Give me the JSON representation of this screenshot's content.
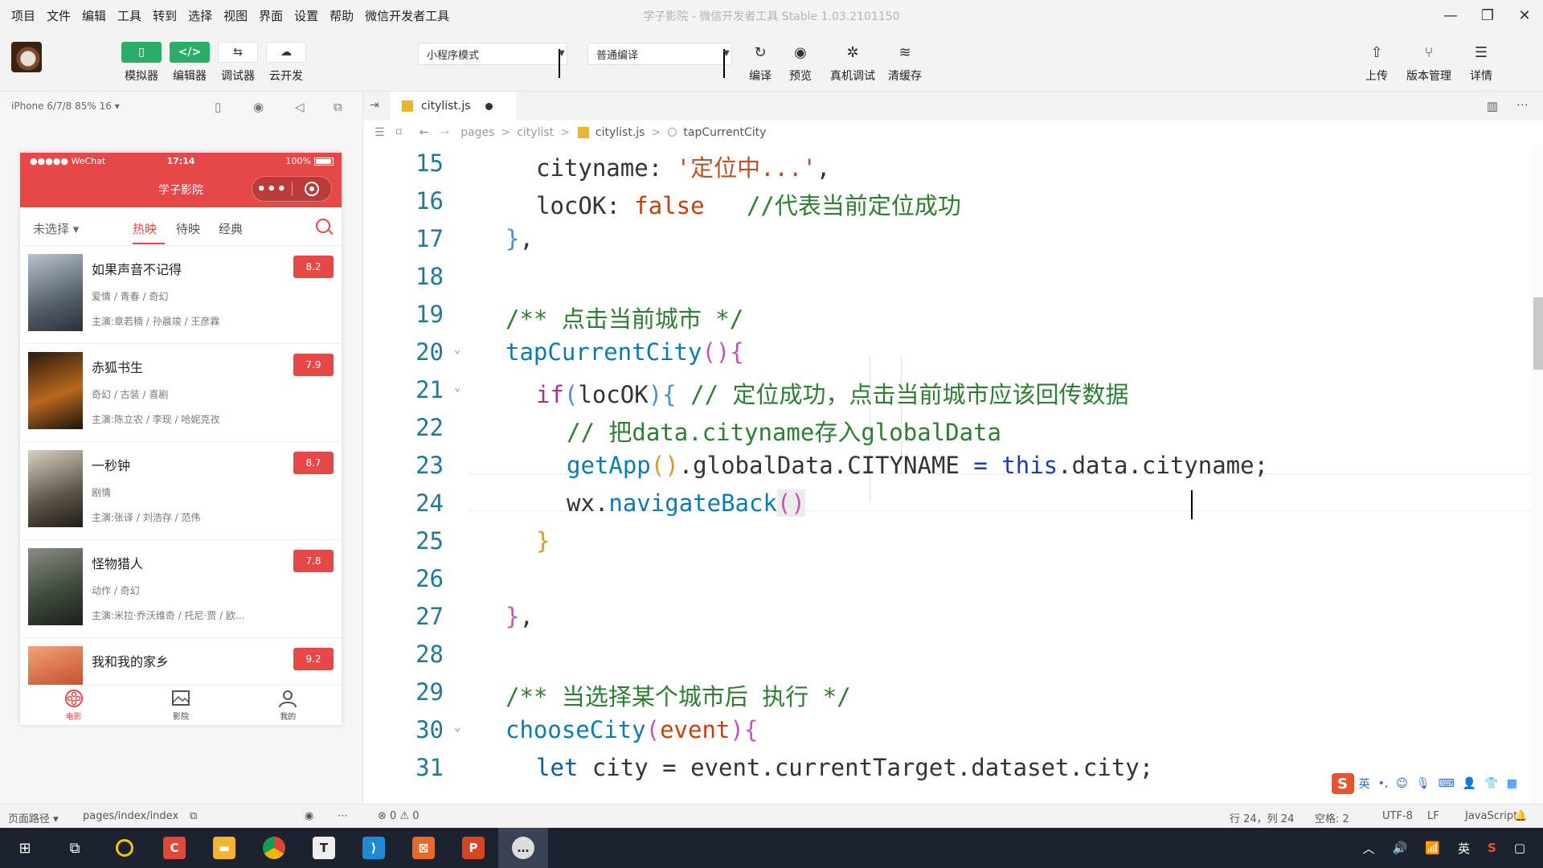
{
  "menu": [
    "项目",
    "文件",
    "编辑",
    "工具",
    "转到",
    "选择",
    "视图",
    "界面",
    "设置",
    "帮助",
    "微信开发者工具"
  ],
  "window_title": "学子影院 - 微信开发者工具 Stable 1.03.2101150",
  "toolbar": {
    "left_buttons": [
      "模拟器",
      "编辑器",
      "调试器",
      "云开发"
    ],
    "mode_select": "小程序模式",
    "compile_select": "普通编译",
    "mid_buttons": [
      "编译",
      "预览",
      "真机调试",
      "清缓存"
    ],
    "right_buttons": [
      "上传",
      "版本管理",
      "详情"
    ]
  },
  "simulator": {
    "device": "iPhone 6/7/8 85% 16 ▾",
    "status_left": "●●●●● WeChat",
    "status_time": "17:14",
    "status_battery": "100%",
    "nav_title": "学子影院",
    "capsule_dots": "•••",
    "city": "未选择 ▾",
    "tabs": [
      "热映",
      "待映",
      "经典"
    ],
    "movies": [
      {
        "name": "如果声音不记得",
        "genre": "爱情 / 青春 / 奇幻",
        "cast": "主演:章若楠 / 孙晨竣 / 王彦霖",
        "score": "8.2"
      },
      {
        "name": "赤狐书生",
        "genre": "奇幻 / 古装 / 喜剧",
        "cast": "主演:陈立农 / 李现 / 哈妮克孜",
        "score": "7.9"
      },
      {
        "name": "一秒钟",
        "genre": "剧情",
        "cast": "主演:张译 / 刘浩存 / 范伟",
        "score": "8.7"
      },
      {
        "name": "怪物猎人",
        "genre": "动作 / 奇幻",
        "cast": "主演:米拉·乔沃维奇 / 托尼·贾 / 欧...",
        "score": "7.8"
      },
      {
        "name": "我和我的家乡",
        "genre": "",
        "cast": "",
        "score": "9.2"
      }
    ],
    "tabbar": [
      "电影",
      "影院",
      "我的"
    ]
  },
  "editor": {
    "file_tab": "citylist.js",
    "breadcrumb": [
      "pages",
      "citylist",
      "citylist.js",
      "tapCurrentCity"
    ]
  },
  "code_lines": [
    {
      "n": "15"
    },
    {
      "n": "16"
    },
    {
      "n": "17"
    },
    {
      "n": "18"
    },
    {
      "n": "19"
    },
    {
      "n": "20"
    },
    {
      "n": "21"
    },
    {
      "n": "22"
    },
    {
      "n": "23"
    },
    {
      "n": "24"
    },
    {
      "n": "25"
    },
    {
      "n": "26"
    },
    {
      "n": "27"
    },
    {
      "n": "28"
    },
    {
      "n": "29"
    },
    {
      "n": "30"
    },
    {
      "n": "31"
    }
  ],
  "code": {
    "l15_key": "cityname",
    "l15_str": "'定位中...'",
    "l16_key": "locOK",
    "l16_val": "false",
    "l16_com": "//代表当前定位成功",
    "l19_com": "/** 点击当前城市 */",
    "l20_fn": "tapCurrentCity",
    "l21_kw": "if",
    "l21_var": "locOK",
    "l21_com": "// 定位成功，点击当前城市应该回传数据",
    "l22_com": "// 把data.cityname存入globalData",
    "l23_fn": "getApp",
    "l23_mid": ".globalData.CITYNAME",
    "l23_this": "this",
    "l23_end": ".data.cityname;",
    "l24_obj": "wx.",
    "l24_fn": "navigateBack",
    "l29_com": "/** 当选择某个城市后 执行 */",
    "l30_fn": "chooseCity",
    "l30_param": "event",
    "l31_kw": "let",
    "l31_rest": " city = event.currentTarget.dataset.city;"
  },
  "ime": {
    "lang": "英"
  },
  "statusbar": {
    "path_label": "页面路径 ▾",
    "path": "pages/index/index",
    "problems": "⊗ 0 ⚠ 0",
    "position": "行 24，列 24",
    "spaces": "空格: 2",
    "encoding": "UTF-8",
    "eol": "LF",
    "language": "JavaScript"
  },
  "taskbar": {
    "ime": "英"
  }
}
